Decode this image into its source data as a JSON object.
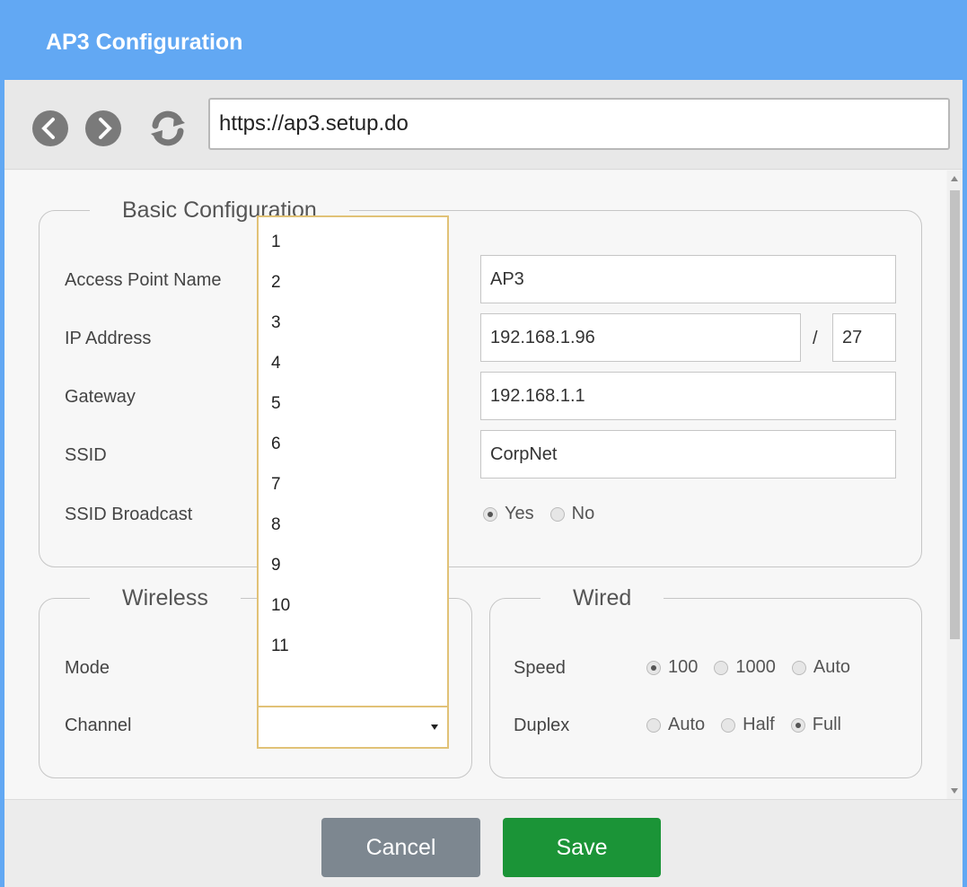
{
  "window": {
    "title": "AP3 Configuration"
  },
  "browser": {
    "url": "https://ap3.setup.do"
  },
  "basic": {
    "legend": "Basic Configuration",
    "access_point_name_label": "Access Point Name",
    "access_point_name_value": "AP3",
    "ip_address_label": "IP Address",
    "ip_address_value": "192.168.1.96",
    "ip_separator": "/",
    "ip_prefix_value": "27",
    "gateway_label": "Gateway",
    "gateway_value": "192.168.1.1",
    "ssid_label": "SSID",
    "ssid_value": "CorpNet",
    "ssid_broadcast_label": "SSID Broadcast",
    "ssid_broadcast_options": [
      "Yes",
      "No"
    ],
    "ssid_broadcast_selected": "Yes"
  },
  "wireless": {
    "legend": "Wireless",
    "mode_label": "Mode",
    "channel_label": "Channel",
    "channel_value": "",
    "channel_options": [
      "1",
      "2",
      "3",
      "4",
      "5",
      "6",
      "7",
      "8",
      "9",
      "10",
      "11"
    ]
  },
  "wired": {
    "legend": "Wired",
    "speed_label": "Speed",
    "speed_options": [
      "100",
      "1000",
      "Auto"
    ],
    "speed_selected": "100",
    "duplex_label": "Duplex",
    "duplex_options": [
      "Auto",
      "Half",
      "Full"
    ],
    "duplex_selected": "Full"
  },
  "footer": {
    "cancel_label": "Cancel",
    "save_label": "Save"
  },
  "colors": {
    "titlebar": "#62a8f3",
    "save": "#1b9437",
    "cancel": "#7d8790",
    "dropdown_border": "#e1c277"
  },
  "icons": [
    "back-icon",
    "forward-icon",
    "refresh-icon"
  ]
}
